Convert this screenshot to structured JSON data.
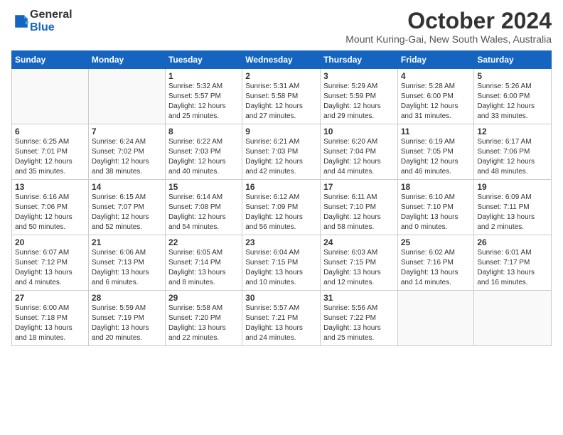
{
  "logo": {
    "text_general": "General",
    "text_blue": "Blue"
  },
  "header": {
    "title": "October 2024",
    "subtitle": "Mount Kuring-Gai, New South Wales, Australia"
  },
  "weekdays": [
    "Sunday",
    "Monday",
    "Tuesday",
    "Wednesday",
    "Thursday",
    "Friday",
    "Saturday"
  ],
  "weeks": [
    [
      {
        "day": "",
        "info": ""
      },
      {
        "day": "",
        "info": ""
      },
      {
        "day": "1",
        "info": "Sunrise: 5:32 AM\nSunset: 5:57 PM\nDaylight: 12 hours\nand 25 minutes."
      },
      {
        "day": "2",
        "info": "Sunrise: 5:31 AM\nSunset: 5:58 PM\nDaylight: 12 hours\nand 27 minutes."
      },
      {
        "day": "3",
        "info": "Sunrise: 5:29 AM\nSunset: 5:59 PM\nDaylight: 12 hours\nand 29 minutes."
      },
      {
        "day": "4",
        "info": "Sunrise: 5:28 AM\nSunset: 6:00 PM\nDaylight: 12 hours\nand 31 minutes."
      },
      {
        "day": "5",
        "info": "Sunrise: 5:26 AM\nSunset: 6:00 PM\nDaylight: 12 hours\nand 33 minutes."
      }
    ],
    [
      {
        "day": "6",
        "info": "Sunrise: 6:25 AM\nSunset: 7:01 PM\nDaylight: 12 hours\nand 35 minutes."
      },
      {
        "day": "7",
        "info": "Sunrise: 6:24 AM\nSunset: 7:02 PM\nDaylight: 12 hours\nand 38 minutes."
      },
      {
        "day": "8",
        "info": "Sunrise: 6:22 AM\nSunset: 7:03 PM\nDaylight: 12 hours\nand 40 minutes."
      },
      {
        "day": "9",
        "info": "Sunrise: 6:21 AM\nSunset: 7:03 PM\nDaylight: 12 hours\nand 42 minutes."
      },
      {
        "day": "10",
        "info": "Sunrise: 6:20 AM\nSunset: 7:04 PM\nDaylight: 12 hours\nand 44 minutes."
      },
      {
        "day": "11",
        "info": "Sunrise: 6:19 AM\nSunset: 7:05 PM\nDaylight: 12 hours\nand 46 minutes."
      },
      {
        "day": "12",
        "info": "Sunrise: 6:17 AM\nSunset: 7:06 PM\nDaylight: 12 hours\nand 48 minutes."
      }
    ],
    [
      {
        "day": "13",
        "info": "Sunrise: 6:16 AM\nSunset: 7:06 PM\nDaylight: 12 hours\nand 50 minutes."
      },
      {
        "day": "14",
        "info": "Sunrise: 6:15 AM\nSunset: 7:07 PM\nDaylight: 12 hours\nand 52 minutes."
      },
      {
        "day": "15",
        "info": "Sunrise: 6:14 AM\nSunset: 7:08 PM\nDaylight: 12 hours\nand 54 minutes."
      },
      {
        "day": "16",
        "info": "Sunrise: 6:12 AM\nSunset: 7:09 PM\nDaylight: 12 hours\nand 56 minutes."
      },
      {
        "day": "17",
        "info": "Sunrise: 6:11 AM\nSunset: 7:10 PM\nDaylight: 12 hours\nand 58 minutes."
      },
      {
        "day": "18",
        "info": "Sunrise: 6:10 AM\nSunset: 7:10 PM\nDaylight: 13 hours\nand 0 minutes."
      },
      {
        "day": "19",
        "info": "Sunrise: 6:09 AM\nSunset: 7:11 PM\nDaylight: 13 hours\nand 2 minutes."
      }
    ],
    [
      {
        "day": "20",
        "info": "Sunrise: 6:07 AM\nSunset: 7:12 PM\nDaylight: 13 hours\nand 4 minutes."
      },
      {
        "day": "21",
        "info": "Sunrise: 6:06 AM\nSunset: 7:13 PM\nDaylight: 13 hours\nand 6 minutes."
      },
      {
        "day": "22",
        "info": "Sunrise: 6:05 AM\nSunset: 7:14 PM\nDaylight: 13 hours\nand 8 minutes."
      },
      {
        "day": "23",
        "info": "Sunrise: 6:04 AM\nSunset: 7:15 PM\nDaylight: 13 hours\nand 10 minutes."
      },
      {
        "day": "24",
        "info": "Sunrise: 6:03 AM\nSunset: 7:15 PM\nDaylight: 13 hours\nand 12 minutes."
      },
      {
        "day": "25",
        "info": "Sunrise: 6:02 AM\nSunset: 7:16 PM\nDaylight: 13 hours\nand 14 minutes."
      },
      {
        "day": "26",
        "info": "Sunrise: 6:01 AM\nSunset: 7:17 PM\nDaylight: 13 hours\nand 16 minutes."
      }
    ],
    [
      {
        "day": "27",
        "info": "Sunrise: 6:00 AM\nSunset: 7:18 PM\nDaylight: 13 hours\nand 18 minutes."
      },
      {
        "day": "28",
        "info": "Sunrise: 5:59 AM\nSunset: 7:19 PM\nDaylight: 13 hours\nand 20 minutes."
      },
      {
        "day": "29",
        "info": "Sunrise: 5:58 AM\nSunset: 7:20 PM\nDaylight: 13 hours\nand 22 minutes."
      },
      {
        "day": "30",
        "info": "Sunrise: 5:57 AM\nSunset: 7:21 PM\nDaylight: 13 hours\nand 24 minutes."
      },
      {
        "day": "31",
        "info": "Sunrise: 5:56 AM\nSunset: 7:22 PM\nDaylight: 13 hours\nand 25 minutes."
      },
      {
        "day": "",
        "info": ""
      },
      {
        "day": "",
        "info": ""
      }
    ]
  ]
}
